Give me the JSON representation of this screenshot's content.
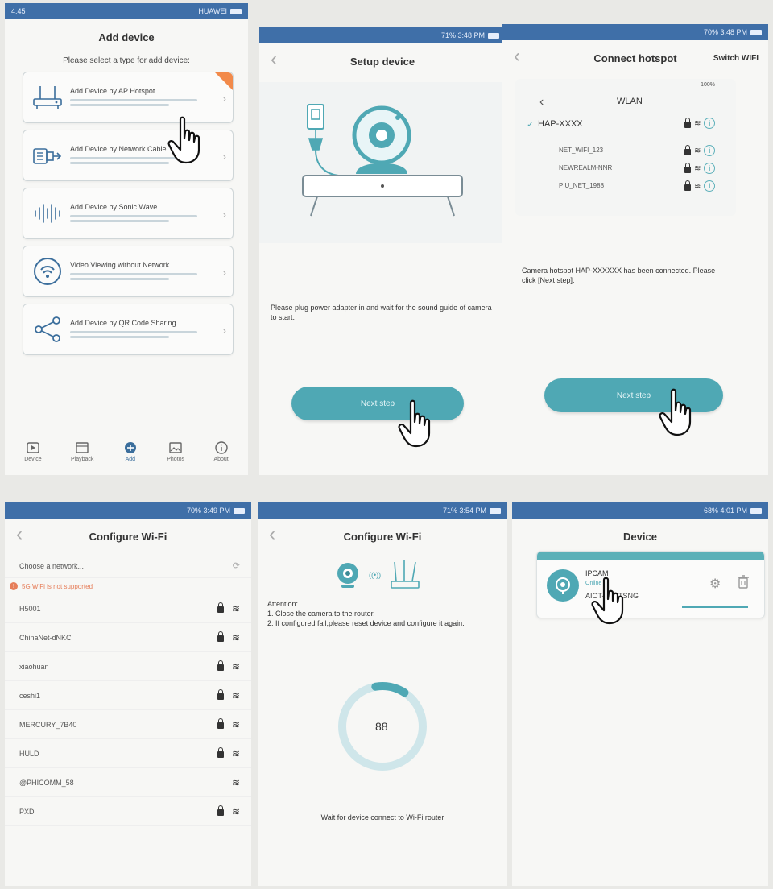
{
  "status": {
    "p1_left": "4:45",
    "p1_right": "HUAWEI",
    "p2": "71%  3:48 PM",
    "p3": "70%  3:48 PM",
    "p4": "70%  3:49 PM",
    "p5": "71%  3:54 PM",
    "p6": "68%  4:01 PM"
  },
  "add_device": {
    "title": "Add device",
    "subtitle": "Please select a type for add device:",
    "options": [
      {
        "label": "Add Device by AP Hotspot",
        "icon": "router-icon"
      },
      {
        "label": "Add Device by Network Cable",
        "icon": "cable-icon"
      },
      {
        "label": "Add Device by Sonic Wave",
        "icon": "sound-wave-icon"
      },
      {
        "label": "Video Viewing without Network",
        "icon": "wireless-icon"
      },
      {
        "label": "Add Device by QR Code Sharing",
        "icon": "share-icon"
      }
    ],
    "tabs": [
      "Device",
      "Playback",
      "Add",
      "Photos",
      "About"
    ]
  },
  "setup": {
    "title": "Setup device",
    "message": "Please plug power adapter in and wait for the sound guide of camera to start.",
    "button": "Next step"
  },
  "connect": {
    "title": "Connect hotspot",
    "switch": "Switch WIFI",
    "wlan_title": "WLAN",
    "wlan_status_right": "100%",
    "networks": [
      "HAP-XXXX",
      "NET_WIFI_123",
      "NEWREALM-NNR",
      "PIU_NET_1988"
    ],
    "message": "Camera hotspot HAP-XXXXXX has been connected. Please click [Next step].",
    "button": "Next step"
  },
  "configure_wifi": {
    "title": "Configure Wi-Fi",
    "choose": "Choose a network...",
    "warning": "5G WiFi is not supported",
    "networks": [
      "H5001",
      "ChinaNet-dNKC",
      "xiaohuan",
      "ceshi1",
      "MERCURY_7B40",
      "HULD",
      "@PHICOMM_58",
      "PXD"
    ]
  },
  "configure_progress": {
    "title": "Configure Wi-Fi",
    "attention": "Attention:",
    "step1": "1. Close the camera to the router.",
    "step2": "2. If configured fail,please reset device and configure it again.",
    "progress": "88",
    "progress_fraction": 0.12,
    "wait": "Wait for device connect to Wi-Fi router"
  },
  "device": {
    "title": "Device",
    "name": "IPCAM",
    "status": "Online",
    "id": "AIOT-00...TSNG"
  }
}
